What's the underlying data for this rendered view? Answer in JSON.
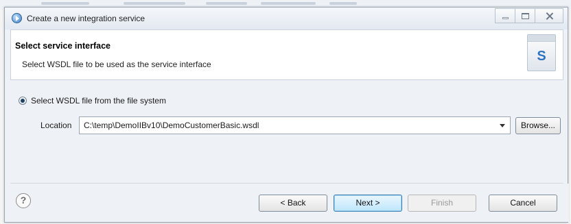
{
  "window": {
    "title": "Create a new integration service"
  },
  "header": {
    "title": "Select service interface",
    "description": "Select WSDL file to be used as the service interface",
    "icon_letter": "S"
  },
  "source": {
    "option_label": "Select WSDL file from the file system",
    "selected": true
  },
  "location": {
    "label": "Location",
    "value": "C:\\temp\\DemoIIBv10\\DemoCustomerBasic.wsdl",
    "browse_label": "Browse..."
  },
  "footer": {
    "help_symbol": "?",
    "back_label": "< Back",
    "next_label": "Next >",
    "finish_label": "Finish",
    "cancel_label": "Cancel"
  }
}
